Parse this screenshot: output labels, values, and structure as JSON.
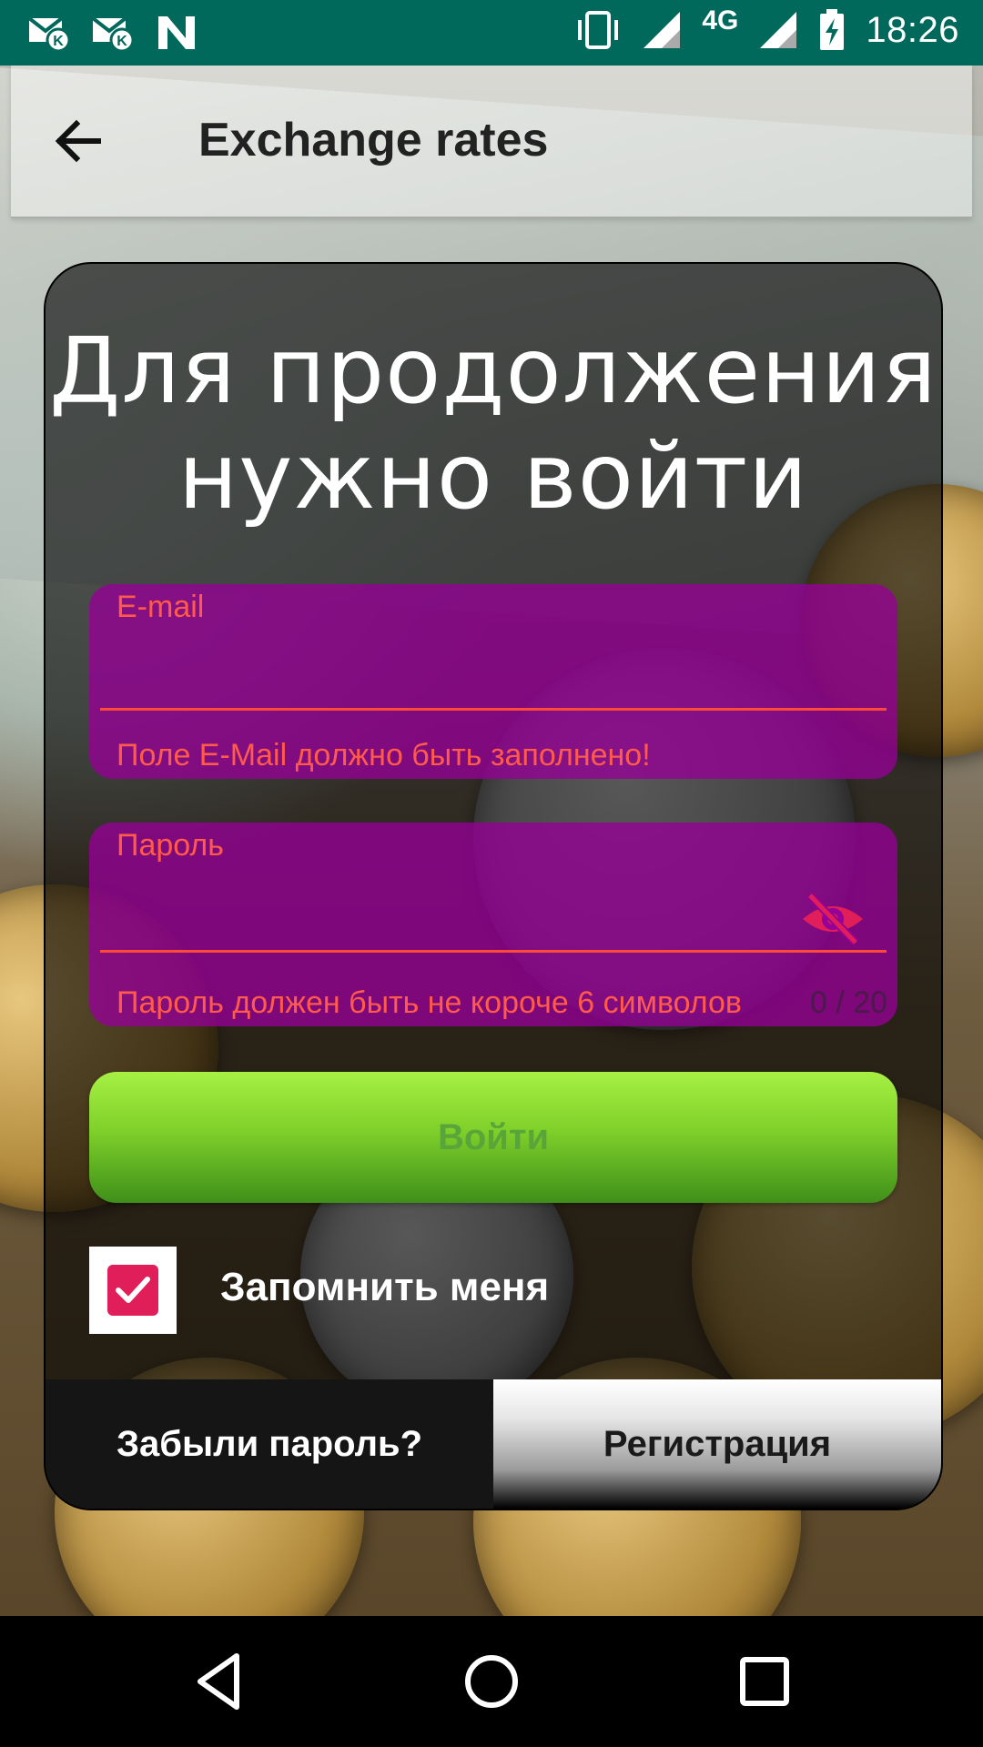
{
  "status_bar": {
    "time": "18:26",
    "network": "4G",
    "icons": [
      "mail-k-icon",
      "mail-k-icon",
      "n-app-icon",
      "vibrate-icon",
      "signal-icon",
      "signal-icon",
      "battery-charging-icon"
    ]
  },
  "app_bar": {
    "title": "Exchange rates",
    "back_icon": "arrow-left-icon"
  },
  "login": {
    "heading_line1": "Для продолжения",
    "heading_line2": "нужно войти",
    "email": {
      "label": "E-mail",
      "value": "",
      "error": "Поле E-Mail должно быть заполнено!"
    },
    "password": {
      "label": "Пароль",
      "value": "",
      "error": "Пароль должен быть не короче 6 символов",
      "counter": "0 / 20",
      "toggle_icon": "eye-off-icon"
    },
    "login_button": "Войти",
    "remember_me": {
      "label": "Запомнить меня",
      "checked": true
    },
    "forgot_button": "Забыли пароль?",
    "register_button": "Регистрация"
  },
  "colors": {
    "status_bar": "#00695c",
    "field_bg": "#960096",
    "error": "#ff5a4a",
    "login_button": "#7fd02a",
    "checkbox": "#e01e5a"
  },
  "nav_bar": {
    "icons": [
      "nav-back-icon",
      "nav-home-icon",
      "nav-recents-icon"
    ]
  }
}
